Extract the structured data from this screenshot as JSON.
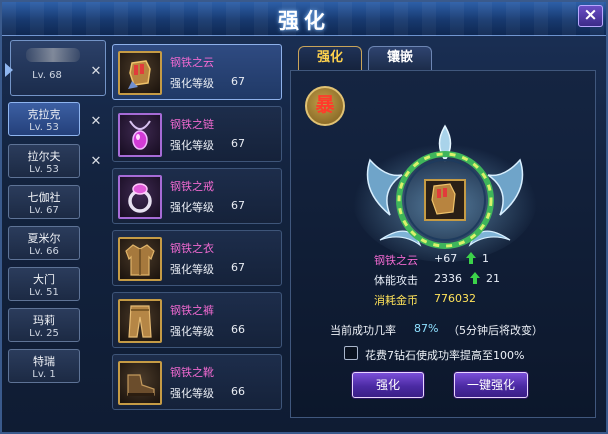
{
  "window": {
    "title": "强化",
    "close_label": "×"
  },
  "characters": [
    {
      "name": "",
      "level": "Lv. 68",
      "redacted": true
    },
    {
      "name": "克拉克",
      "level": "Lv. 53"
    },
    {
      "name": "拉尔夫",
      "level": "Lv. 53"
    },
    {
      "name": "七伽社",
      "level": "Lv. 67"
    },
    {
      "name": "夏米尔",
      "level": "Lv. 66"
    },
    {
      "name": "大门",
      "level": "Lv. 51"
    },
    {
      "name": "玛莉",
      "level": "Lv. 25"
    },
    {
      "name": "特瑞",
      "level": "Lv. 1"
    }
  ],
  "equipment": [
    {
      "name": "钢铁之云",
      "level_label": "强化等级",
      "level": "67",
      "icon": "gauntlet-icon"
    },
    {
      "name": "钢铁之链",
      "level_label": "强化等级",
      "level": "67",
      "icon": "necklace-icon"
    },
    {
      "name": "钢铁之戒",
      "level_label": "强化等级",
      "level": "67",
      "icon": "ring-icon"
    },
    {
      "name": "钢铁之衣",
      "level_label": "强化等级",
      "level": "67",
      "icon": "coat-icon"
    },
    {
      "name": "钢铁之裤",
      "level_label": "强化等级",
      "level": "66",
      "icon": "pants-icon"
    },
    {
      "name": "钢铁之靴",
      "level_label": "强化等级",
      "level": "66",
      "icon": "boots-icon"
    }
  ],
  "tabs": [
    {
      "label": "强化",
      "active": true
    },
    {
      "label": "镶嵌",
      "active": false
    }
  ],
  "badge": "暴",
  "stats": {
    "item": {
      "label": "钢铁之云",
      "value": "+67",
      "increase": "1"
    },
    "attack": {
      "label": "体能攻击",
      "value": "2336",
      "increase": "21"
    },
    "cost": {
      "label": "消耗金币",
      "value": "776032"
    }
  },
  "success": {
    "label": "当前成功几率",
    "rate": "87%",
    "note": "（5分钟后将改变）"
  },
  "diamond_option": {
    "label": "花费7钻石使成功率提高至100%",
    "checked": false
  },
  "buttons": {
    "enhance": "强化",
    "one_key": "一键强化"
  },
  "colors": {
    "accent_gold": "#ffd24d",
    "equip_name": "#f16ad1",
    "stat_label_pink": "#f16ad1",
    "cost_gold": "#ffe35a",
    "rate_blue": "#8fe0ff",
    "arrow_green": "#3cd34a"
  }
}
